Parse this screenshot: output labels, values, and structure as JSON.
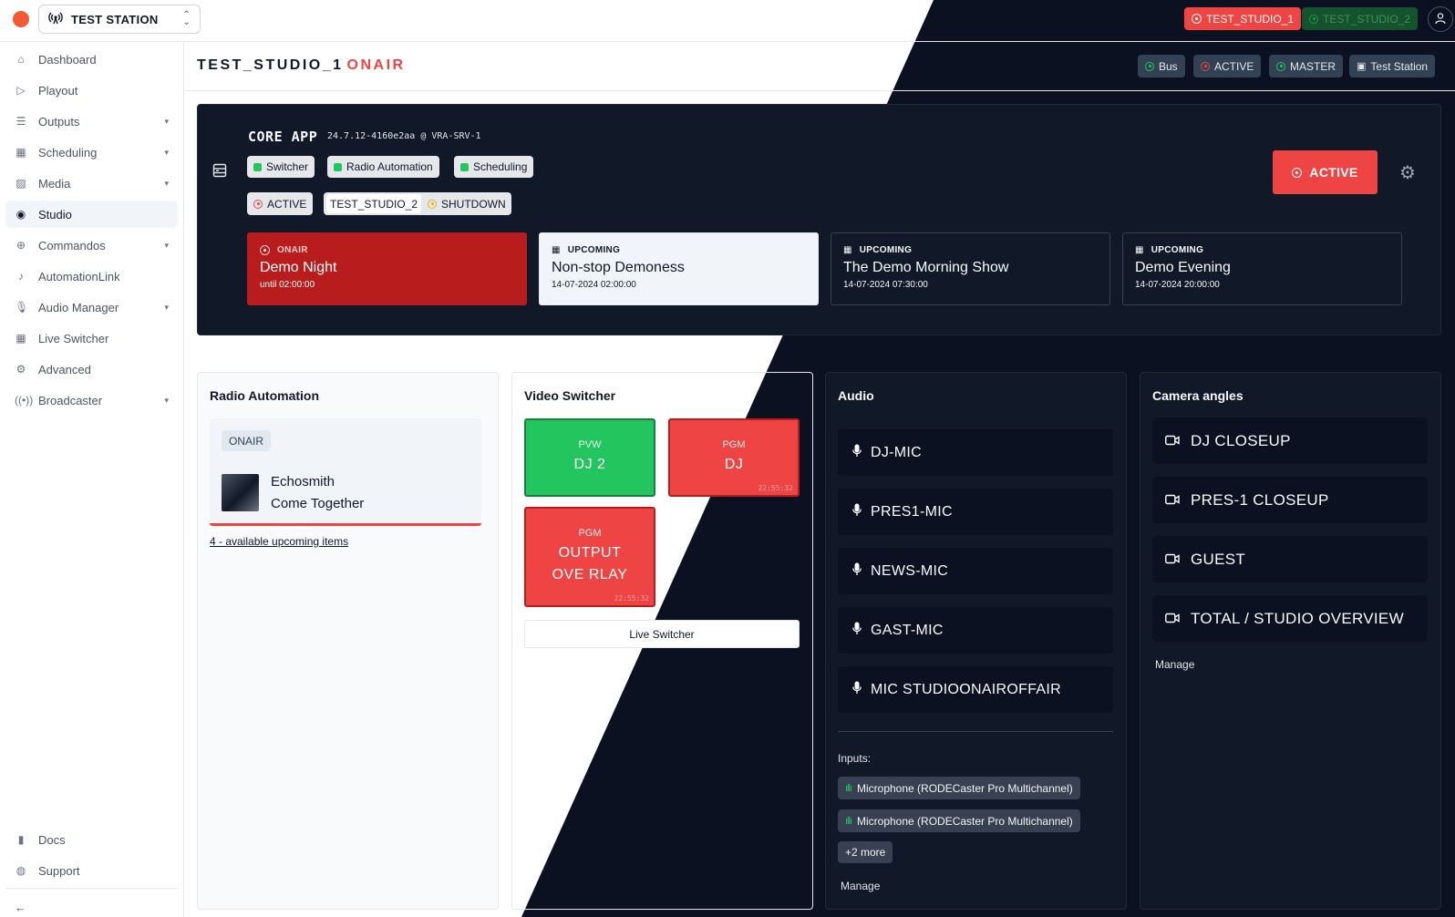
{
  "topbar": {
    "station": "TEST STATION",
    "studios": [
      {
        "label": "TEST_STUDIO_1",
        "state": "active"
      },
      {
        "label": "TEST_STUDIO_2",
        "state": "inactive"
      }
    ]
  },
  "sidebar": {
    "items": [
      {
        "label": "Dashboard",
        "icon": "home-icon"
      },
      {
        "label": "Playout",
        "icon": "play-icon"
      },
      {
        "label": "Outputs",
        "icon": "list-icon"
      },
      {
        "label": "Scheduling",
        "icon": "calendar-icon"
      },
      {
        "label": "Media",
        "icon": "image-icon"
      },
      {
        "label": "Studio",
        "icon": "record-icon"
      },
      {
        "label": "Commandos",
        "icon": "command-icon"
      },
      {
        "label": "AutomationLink",
        "icon": "music-icon"
      },
      {
        "label": "Audio Manager",
        "icon": "mic-icon"
      },
      {
        "label": "Live Switcher",
        "icon": "grid-icon"
      },
      {
        "label": "Advanced",
        "icon": "settings-icon"
      },
      {
        "label": "Broadcaster",
        "icon": "broadcast-icon"
      }
    ],
    "footer": [
      {
        "label": "Docs",
        "icon": "book-icon"
      },
      {
        "label": "Support",
        "icon": "globe-icon"
      }
    ]
  },
  "header": {
    "title": "TEST_STUDIO_1",
    "status": "ONAIR",
    "badges": [
      "Bus",
      "ACTIVE",
      "MASTER",
      "Test Station"
    ]
  },
  "core": {
    "title": "CORE APP",
    "version": "24.7.12-4160e2aa @ VRA-SRV-1",
    "features": [
      "Switcher",
      "Radio Automation",
      "Scheduling"
    ],
    "state": "ACTIVE",
    "peer_studio": "TEST_STUDIO_2",
    "peer_state": "SHUTDOWN",
    "active_button": "ACTIVE",
    "schedule": [
      {
        "label": "ONAIR",
        "title": "Demo Night",
        "sub": "until 02:00:00"
      },
      {
        "label": "UPCOMING",
        "title": "Non-stop Demoness",
        "sub": "14-07-2024 02:00:00"
      },
      {
        "label": "UPCOMING",
        "title": "The Demo Morning Show",
        "sub": "14-07-2024 07:30:00"
      },
      {
        "label": "UPCOMING",
        "title": "Demo Evening",
        "sub": "14-07-2024 20:00:00"
      }
    ]
  },
  "radio_automation": {
    "title": "Radio Automation",
    "chip": "ONAIR",
    "artist": "Echosmith",
    "song": "Come Together",
    "upcoming_link": "4 - available upcoming items"
  },
  "video_switcher": {
    "title": "Video Switcher",
    "tiles": [
      {
        "kind": "PVW",
        "name": "DJ 2",
        "time": ""
      },
      {
        "kind": "PGM",
        "name": "DJ",
        "time": "22:55:32"
      },
      {
        "kind": "PGM",
        "name": "OUTPUT OVE RLAY",
        "time": "22:55:32"
      }
    ],
    "button": "Live Switcher"
  },
  "audio": {
    "title": "Audio",
    "mics": [
      "DJ-MIC",
      "PRES1-MIC",
      "NEWS-MIC",
      "GAST-MIC",
      "MIC STUDIOONAIROFFAIR"
    ],
    "inputs_label": "Inputs:",
    "inputs": [
      "Microphone (RODECaster Pro Multichannel)",
      "Microphone (RODECaster Pro Multichannel)"
    ],
    "more": "+2 more",
    "manage": "Manage"
  },
  "cameras": {
    "title": "Camera angles",
    "angles": [
      "DJ CLOSEUP",
      "PRES-1 CLOSEUP",
      "GUEST",
      "TOTAL / STUDIO OVERVIEW"
    ],
    "manage": "Manage"
  },
  "colors": {
    "accent_red": "#ef4444",
    "onair_card": "#b91c1c",
    "preview_green": "#22c55e",
    "dark_bg": "#0b1120"
  }
}
